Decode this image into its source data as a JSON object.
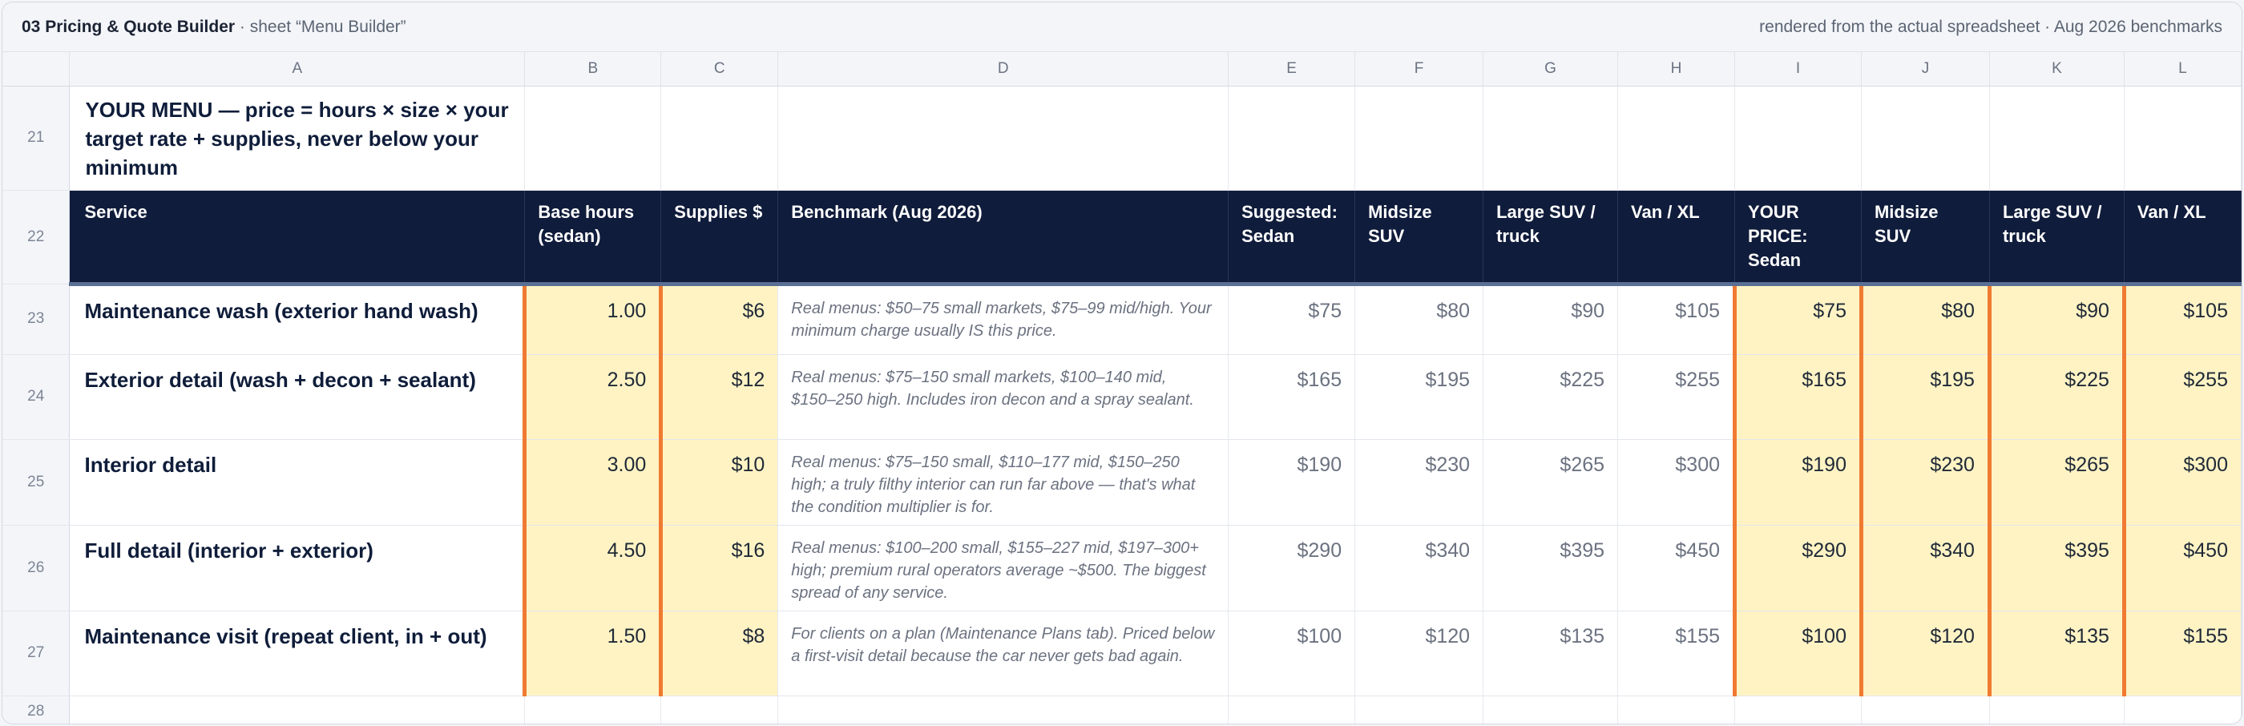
{
  "window": {
    "file_title": "03 Pricing & Quote Builder",
    "sheet_label": "· sheet “Menu Builder”",
    "right_note": "rendered from the actual spreadsheet · Aug 2026 benchmarks"
  },
  "columns": [
    "A",
    "B",
    "C",
    "D",
    "E",
    "F",
    "G",
    "H",
    "I",
    "J",
    "K",
    "L"
  ],
  "row_numbers": {
    "r21": "21",
    "r22": "22",
    "r28": "28"
  },
  "title_row": {
    "text": "YOUR MENU — price = hours × size × your target rate + supplies, never below your minimum"
  },
  "header": {
    "service": "Service",
    "base_hours": "Base hours (sedan)",
    "supplies": "Supplies $",
    "benchmark": "Benchmark (Aug 2026)",
    "sug_sedan": "Suggested: Sedan",
    "sug_midsize": "Midsize SUV",
    "sug_large": "Large SUV / truck",
    "sug_van": "Van / XL",
    "your_sedan": "YOUR PRICE: Sedan",
    "your_midsize": "Midsize SUV",
    "your_large": "Large SUV / truck",
    "your_van": "Van / XL"
  },
  "rows": [
    {
      "row": "23",
      "service": "Maintenance wash (exterior hand wash)",
      "hours": "1.00",
      "supplies": "$6",
      "benchmark": "Real menus: $50–75 small markets, $75–99 mid/high. Your minimum charge usually IS this price.",
      "sug": [
        "$75",
        "$80",
        "$90",
        "$105"
      ],
      "your": [
        "$75",
        "$80",
        "$90",
        "$105"
      ]
    },
    {
      "row": "24",
      "service": "Exterior detail (wash + decon + sealant)",
      "hours": "2.50",
      "supplies": "$12",
      "benchmark": "Real menus: $75–150 small markets, $100–140 mid, $150–250 high. Includes iron decon and a spray sealant.",
      "sug": [
        "$165",
        "$195",
        "$225",
        "$255"
      ],
      "your": [
        "$165",
        "$195",
        "$225",
        "$255"
      ]
    },
    {
      "row": "25",
      "service": "Interior detail",
      "hours": "3.00",
      "supplies": "$10",
      "benchmark": "Real menus: $75–150 small, $110–177 mid, $150–250 high; a truly filthy interior can run far above — that's what the condition multiplier is for.",
      "sug": [
        "$190",
        "$230",
        "$265",
        "$300"
      ],
      "your": [
        "$190",
        "$230",
        "$265",
        "$300"
      ]
    },
    {
      "row": "26",
      "service": "Full detail (interior + exterior)",
      "hours": "4.50",
      "supplies": "$16",
      "benchmark": "Real menus: $100–200 small, $155–227 mid, $197–300+ high; premium rural operators average ~$500. The biggest spread of any service.",
      "sug": [
        "$290",
        "$340",
        "$395",
        "$450"
      ],
      "your": [
        "$290",
        "$340",
        "$395",
        "$450"
      ]
    },
    {
      "row": "27",
      "service": "Maintenance visit (repeat client, in + out)",
      "hours": "1.50",
      "supplies": "$8",
      "benchmark": "For clients on a plan (Maintenance Plans tab). Priced below a first-visit detail because the car never gets bad again.",
      "sug": [
        "$100",
        "$120",
        "$135",
        "$155"
      ],
      "your": [
        "$100",
        "$120",
        "$135",
        "$155"
      ]
    }
  ]
}
